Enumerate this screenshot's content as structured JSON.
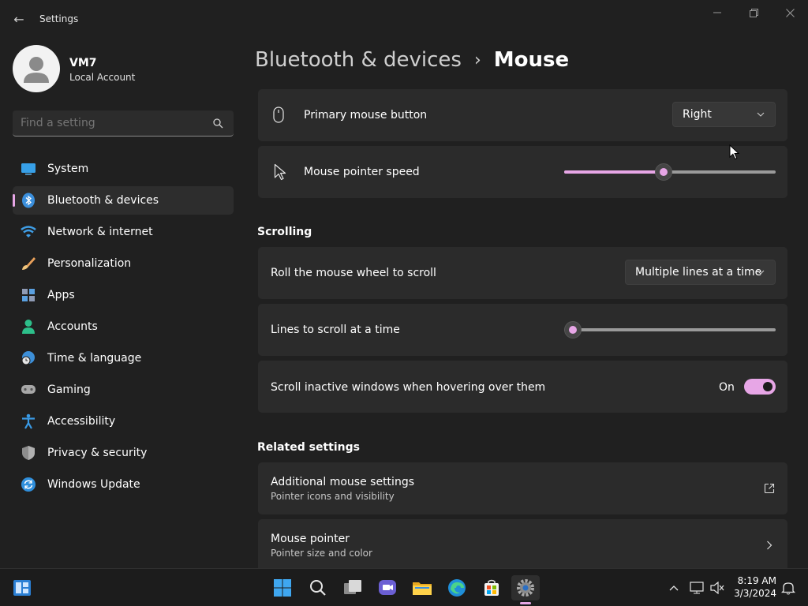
{
  "window": {
    "title": "Settings"
  },
  "profile": {
    "name": "VM7",
    "account": "Local Account"
  },
  "search": {
    "placeholder": "Find a setting"
  },
  "sidebar": {
    "items": [
      {
        "label": "System",
        "icon": "system-icon"
      },
      {
        "label": "Bluetooth & devices",
        "icon": "bluetooth-icon",
        "selected": true
      },
      {
        "label": "Network & internet",
        "icon": "wifi-icon"
      },
      {
        "label": "Personalization",
        "icon": "brush-icon"
      },
      {
        "label": "Apps",
        "icon": "apps-icon"
      },
      {
        "label": "Accounts",
        "icon": "person-icon"
      },
      {
        "label": "Time & language",
        "icon": "globe-clock-icon"
      },
      {
        "label": "Gaming",
        "icon": "gamepad-icon"
      },
      {
        "label": "Accessibility",
        "icon": "accessibility-icon"
      },
      {
        "label": "Privacy & security",
        "icon": "shield-icon"
      },
      {
        "label": "Windows Update",
        "icon": "update-icon"
      }
    ]
  },
  "breadcrumb": {
    "parent": "Bluetooth & devices",
    "separator": "›",
    "current": "Mouse"
  },
  "settings": {
    "primary_button": {
      "label": "Primary mouse button",
      "value": "Right"
    },
    "pointer_speed": {
      "label": "Mouse pointer speed",
      "value_fraction": 0.47
    },
    "scrolling_header": "Scrolling",
    "roll_wheel": {
      "label": "Roll the mouse wheel to scroll",
      "value": "Multiple lines at a time"
    },
    "lines_to_scroll": {
      "label": "Lines to scroll at a time",
      "value_fraction": 0.04
    },
    "scroll_inactive": {
      "label": "Scroll inactive windows when hovering over them",
      "state": "On"
    },
    "related_header": "Related settings",
    "additional": {
      "label": "Additional mouse settings",
      "sub": "Pointer icons and visibility"
    },
    "mouse_pointer": {
      "label": "Mouse pointer",
      "sub": "Pointer size and color"
    }
  },
  "taskbar": {
    "time": "8:19 AM",
    "date": "3/3/2024"
  },
  "colors": {
    "accent": "#e7a6e6",
    "background": "#202020",
    "card": "#2b2b2b"
  }
}
